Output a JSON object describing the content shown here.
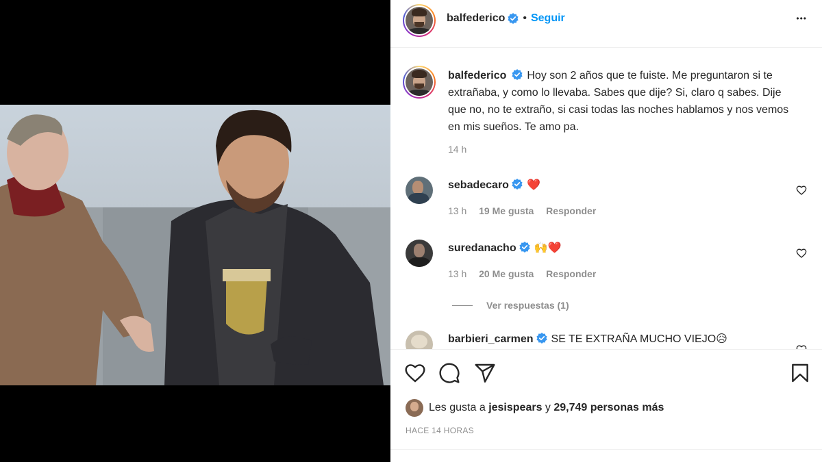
{
  "header": {
    "username": "balfederico",
    "follow_label": "Seguir",
    "dot": "•",
    "more_label": "•••"
  },
  "caption": {
    "username": "balfederico",
    "text": "Hoy son 2 años que te fuiste. Me preguntaron si te extrañaba, y como lo llevaba. Sabes que dije? Si, claro q sabes. Dije que no, no te extraño, si casi todas las noches hablamos y nos vemos en mis sueños. Te amo pa.",
    "time": "14 h"
  },
  "comments": [
    {
      "username": "sebadecaro",
      "text": "❤️",
      "time": "13 h",
      "likes": "19 Me gusta",
      "reply": "Responder"
    },
    {
      "username": "suredanacho",
      "text": "🙌❤️",
      "time": "13 h",
      "likes": "20 Me gusta",
      "reply": "Responder"
    },
    {
      "username": "barbieri_carmen",
      "text": "SE TE EXTRAÑA MUCHO VIEJO😥"
    }
  ],
  "view_replies": "Ver respuestas (1)",
  "likes_line": {
    "prefix": "Les gusta a",
    "user": "jesispears",
    "middle": "y",
    "count": "29,749 personas más"
  },
  "timestamp": "HACE 14 HORAS",
  "colors": {
    "link": "#0095f6",
    "verified": "#3897f0",
    "heart": "#ed4956",
    "muted": "#8e8e8e"
  },
  "icons": [
    "heart-icon",
    "comment-icon",
    "share-icon",
    "bookmark-icon",
    "verified-icon",
    "more-icon"
  ]
}
